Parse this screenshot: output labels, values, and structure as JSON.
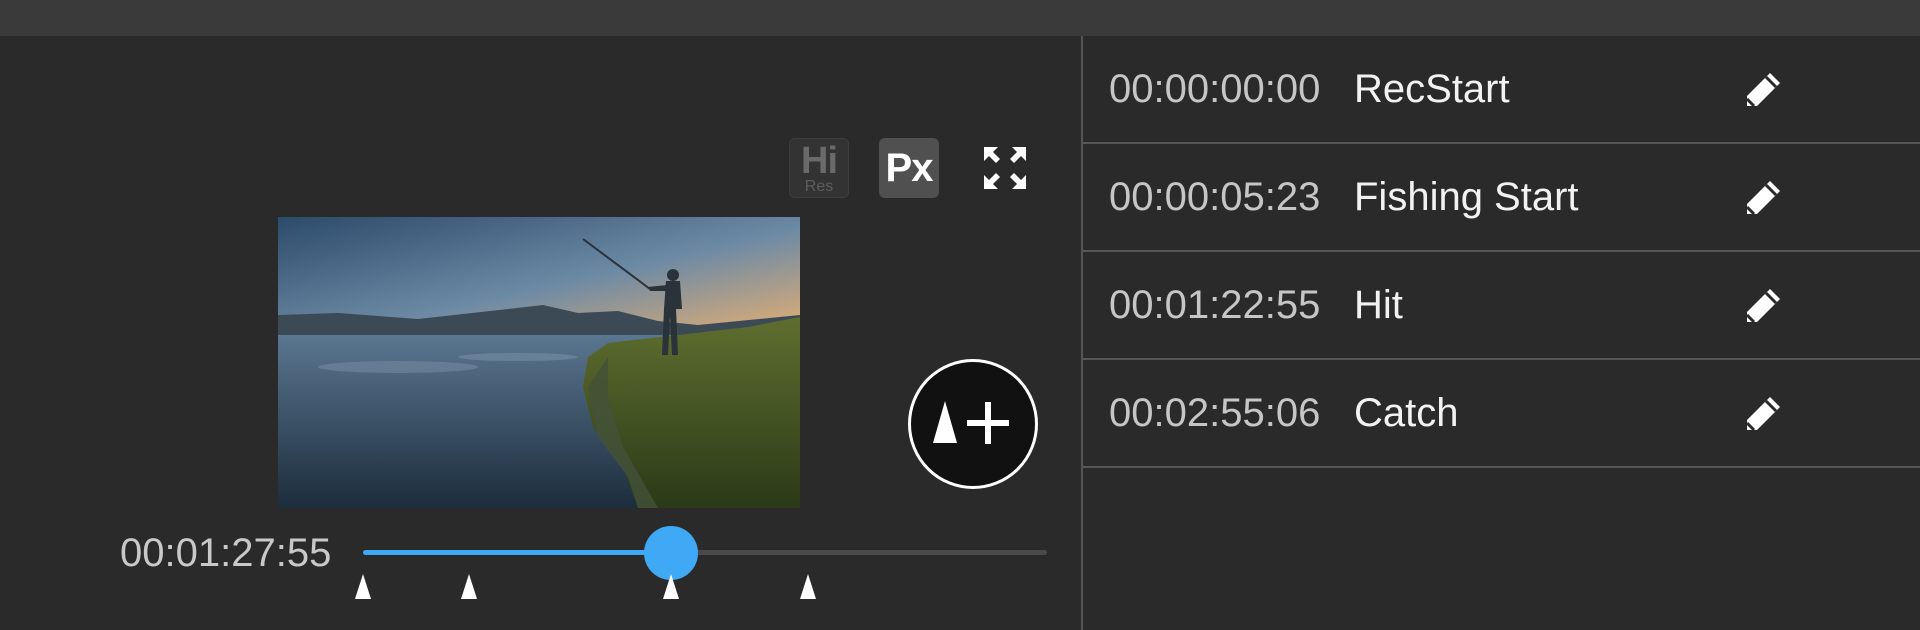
{
  "player": {
    "hires_label": "Hi",
    "hires_sub": "Res",
    "px_label": "Px",
    "current_time": "00:01:27:55",
    "progress": 0.45
  },
  "timeline_markers": [
    0.0,
    0.155,
    0.45,
    0.65
  ],
  "markers": [
    {
      "time": "00:00:00:00",
      "name": "RecStart"
    },
    {
      "time": "00:00:05:23",
      "name": "Fishing Start"
    },
    {
      "time": "00:01:22:55",
      "name": "Hit"
    },
    {
      "time": "00:02:55:06",
      "name": "Catch"
    }
  ],
  "icons": {
    "expand": "fullscreen-expand-icon",
    "add_marker": "add-marker-icon",
    "edit": "pencil-icon"
  },
  "colors": {
    "accent": "#3fa9f5",
    "background": "#2a2a2a",
    "topbar": "#3a3a3a"
  }
}
